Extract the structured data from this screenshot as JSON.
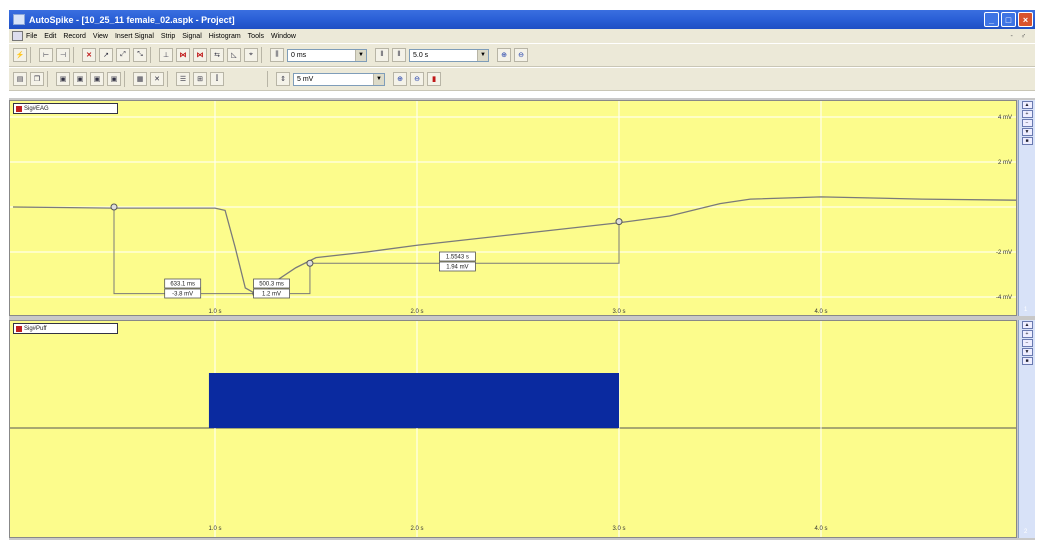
{
  "window": {
    "title": "AutoSpike - [10_25_11 female_02.aspk - Project]",
    "menu": [
      "File",
      "Edit",
      "Record",
      "View",
      "Insert Signal",
      "Strip",
      "Signal",
      "Histogram",
      "Tools",
      "Window"
    ]
  },
  "toolbar": {
    "offset_value": "0 ms",
    "timebase_value": "5.0 s",
    "amplitude_value": "5 mV"
  },
  "channel1": {
    "name": "Sig#EAG",
    "y_ticks": [
      {
        "label": "4 mV",
        "value": 4
      },
      {
        "label": "2 mV",
        "value": 2
      },
      {
        "label": "-2 mV",
        "value": -2
      },
      {
        "label": "-4 mV",
        "value": -4
      }
    ],
    "x_ticks": [
      {
        "label": "1.0 s",
        "value": 1.0
      },
      {
        "label": "2.0 s",
        "value": 2.0
      },
      {
        "label": "3.0 s",
        "value": 3.0
      },
      {
        "label": "4.0 s",
        "value": 4.0
      }
    ],
    "trace": [
      [
        0.0,
        0.0
      ],
      [
        0.5,
        -0.05
      ],
      [
        1.0,
        -0.05
      ],
      [
        1.05,
        -0.15
      ],
      [
        1.1,
        -1.8
      ],
      [
        1.15,
        -3.6
      ],
      [
        1.2,
        -3.85
      ],
      [
        1.25,
        -3.8
      ],
      [
        1.3,
        -3.3
      ],
      [
        1.4,
        -2.7
      ],
      [
        1.5,
        -2.25
      ],
      [
        1.75,
        -2.0
      ],
      [
        2.0,
        -1.7
      ],
      [
        2.5,
        -1.2
      ],
      [
        3.0,
        -0.7
      ],
      [
        3.25,
        -0.4
      ],
      [
        3.5,
        0.15
      ],
      [
        3.65,
        0.35
      ],
      [
        4.0,
        0.45
      ],
      [
        4.5,
        0.35
      ],
      [
        5.0,
        0.3
      ]
    ],
    "cursors": [
      {
        "time": 0.5,
        "value": 0.0
      },
      {
        "time": 1.47,
        "value": -2.5
      },
      {
        "time": 3.0,
        "value": -0.65
      }
    ],
    "measurements": [
      {
        "dt": "633.1 ms",
        "dv": "-3.8 mV",
        "x": 0.84,
        "y": -3.6
      },
      {
        "dt": "500.3 ms",
        "dv": "1.2 mV",
        "x": 1.28,
        "y": -3.6
      },
      {
        "dt": "1.5543 s",
        "dv": "1.94 mV",
        "x": 2.2,
        "y": -2.4
      }
    ]
  },
  "channel2": {
    "name": "Sig#Puff",
    "pulse": {
      "start": 0.97,
      "end": 3.0
    },
    "x_ticks": [
      {
        "label": "1.0 s",
        "value": 1.0
      },
      {
        "label": "2.0 s",
        "value": 2.0
      },
      {
        "label": "3.0 s",
        "value": 3.0
      },
      {
        "label": "4.0 s",
        "value": 4.0
      }
    ]
  },
  "panel_numbers": [
    "1",
    "2"
  ],
  "colors": {
    "plot_bg": "#fcfc8c",
    "trace": "#7a7a7a",
    "pulse": "#0a2aa0",
    "grid": "#ffffff"
  }
}
